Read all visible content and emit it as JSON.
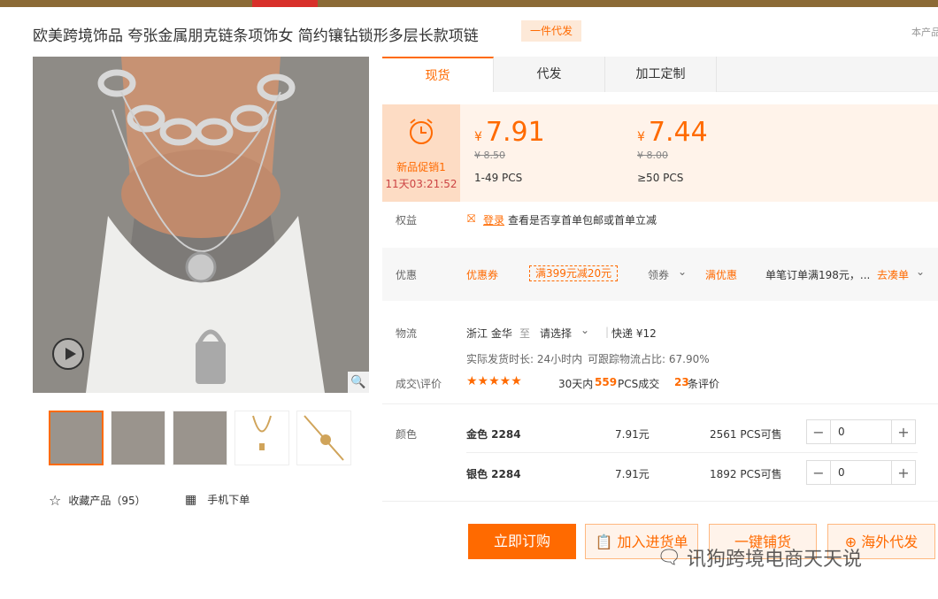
{
  "page": {
    "title": "欧美跨境饰品 夸张金属朋克链条项饰女 简约镶钻锁形多层长款项链",
    "tag": "一件代发",
    "right_note": "本产品"
  },
  "tabs": [
    {
      "label": "现货"
    },
    {
      "label": "代发"
    },
    {
      "label": "加工定制"
    }
  ],
  "promo": {
    "label": "新品促销1",
    "countdown": "11天03:21:52"
  },
  "tiers": [
    {
      "currency": "¥",
      "price": "7.91",
      "orig": "¥ 8.50",
      "qty": "1-49 PCS"
    },
    {
      "currency": "¥",
      "price": "7.44",
      "orig": "¥ 8.00",
      "qty": "≥50 PCS"
    }
  ],
  "benefit": {
    "label": "权益",
    "login": "登录",
    "text": "查看是否享首单包邮或首单立减"
  },
  "discount": {
    "label": "优惠",
    "coupon_label": "优惠券",
    "coupon_value": "满399元减20元",
    "get_coupon": "领券",
    "full_off": "满优惠",
    "full_desc": "单笔订单满198元，...",
    "go": "去凑单"
  },
  "logistics": {
    "label": "物流",
    "origin": "浙江 金华",
    "to": "至",
    "select": "请选择",
    "express": "快递 ¥12",
    "ship_time": "实际发货时长: 24小时内",
    "track": "可跟踪物流占比: 67.90%"
  },
  "review": {
    "label": "成交\\评价",
    "stars": "★★★★★",
    "days": "30天内",
    "count": "559",
    "count_unit": "PCS成交",
    "reviews": "23",
    "reviews_unit": "条评价"
  },
  "color": {
    "label": "颜色",
    "items": [
      {
        "name": "金色 2284",
        "price": "7.91元",
        "stock": "2561 PCS可售",
        "qty": "0",
        "minus": "−",
        "plus": "+"
      },
      {
        "name": "银色 2284",
        "price": "7.91元",
        "stock": "1892 PCS可售",
        "qty": "0",
        "minus": "−",
        "plus": "+"
      }
    ]
  },
  "gallery": {
    "fav": "收藏产品（95）",
    "mobile": "手机下单"
  },
  "actions": {
    "order": "立即订购",
    "cart": "加入进货单",
    "oneclick": "一键铺货",
    "overseas": "海外代发"
  },
  "watermark": "讯狗跨境电商天天说",
  "colors": {
    "accent": "#ff6a00",
    "promo_bg": "#fddcc4",
    "price_bg": "#fff3ea"
  }
}
